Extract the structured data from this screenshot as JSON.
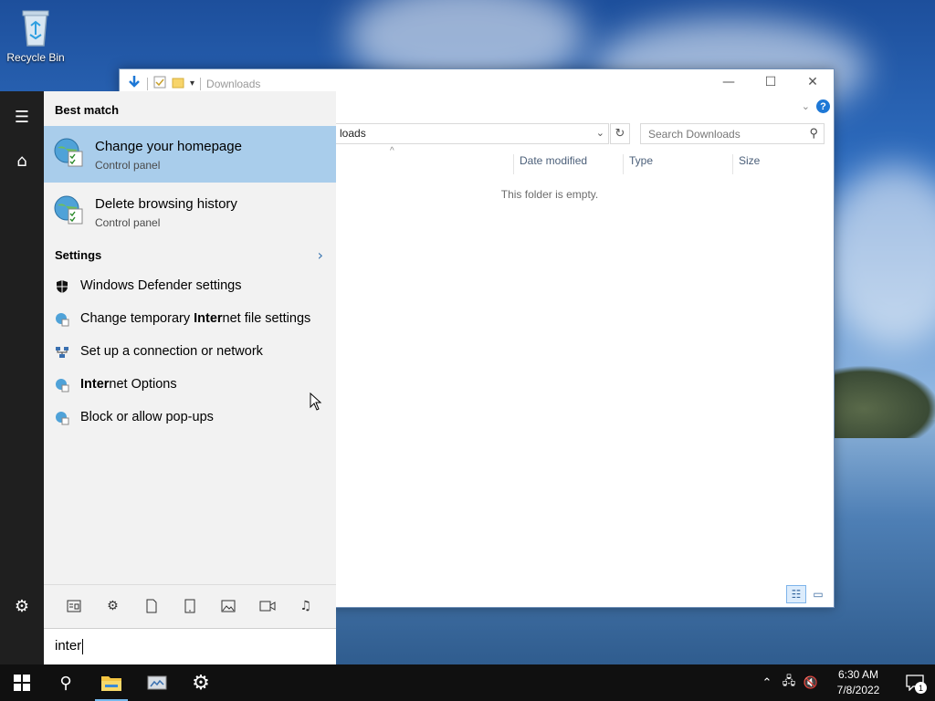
{
  "desktop": {
    "recycle_bin_label": "Recycle Bin"
  },
  "explorer": {
    "title": "Downloads",
    "address_text": "loads",
    "search_placeholder": "Search Downloads",
    "columns": [
      "Date modified",
      "Type",
      "Size"
    ],
    "empty_message": "This folder is empty.",
    "help_label": "?"
  },
  "start_menu": {
    "best_match_heading": "Best match",
    "best_match_items": [
      {
        "title": "Change your homepage",
        "subtitle": "Control panel",
        "selected": true
      },
      {
        "title": "Delete browsing history",
        "subtitle": "Control panel",
        "selected": false
      }
    ],
    "settings_heading": "Settings",
    "settings_items": [
      {
        "pre": "Windows Defender settings",
        "bold": "",
        "post": "",
        "icon": "shield-icon"
      },
      {
        "pre": "Change temporary ",
        "bold": "Inter",
        "post": "net file settings",
        "icon": "internet-options-icon"
      },
      {
        "pre": "Set up a connection or network",
        "bold": "",
        "post": "",
        "icon": "network-icon"
      },
      {
        "pre": "",
        "bold": "Inter",
        "post": "net Options",
        "icon": "internet-options-icon"
      },
      {
        "pre": "Block or allow pop-ups",
        "bold": "",
        "post": "",
        "icon": "internet-options-icon"
      }
    ],
    "filters": [
      "apps-filter-icon",
      "settings-filter-icon",
      "documents-filter-icon",
      "tablet-filter-icon",
      "photos-filter-icon",
      "videos-filter-icon",
      "music-filter-icon"
    ],
    "search_query": "inter"
  },
  "taskbar": {
    "time": "6:30 AM",
    "date": "7/8/2022",
    "notification_count": "1"
  },
  "colors": {
    "selected_highlight": "#a9cdeb",
    "taskbar_bg": "#101010",
    "accent": "#1e78d6"
  }
}
